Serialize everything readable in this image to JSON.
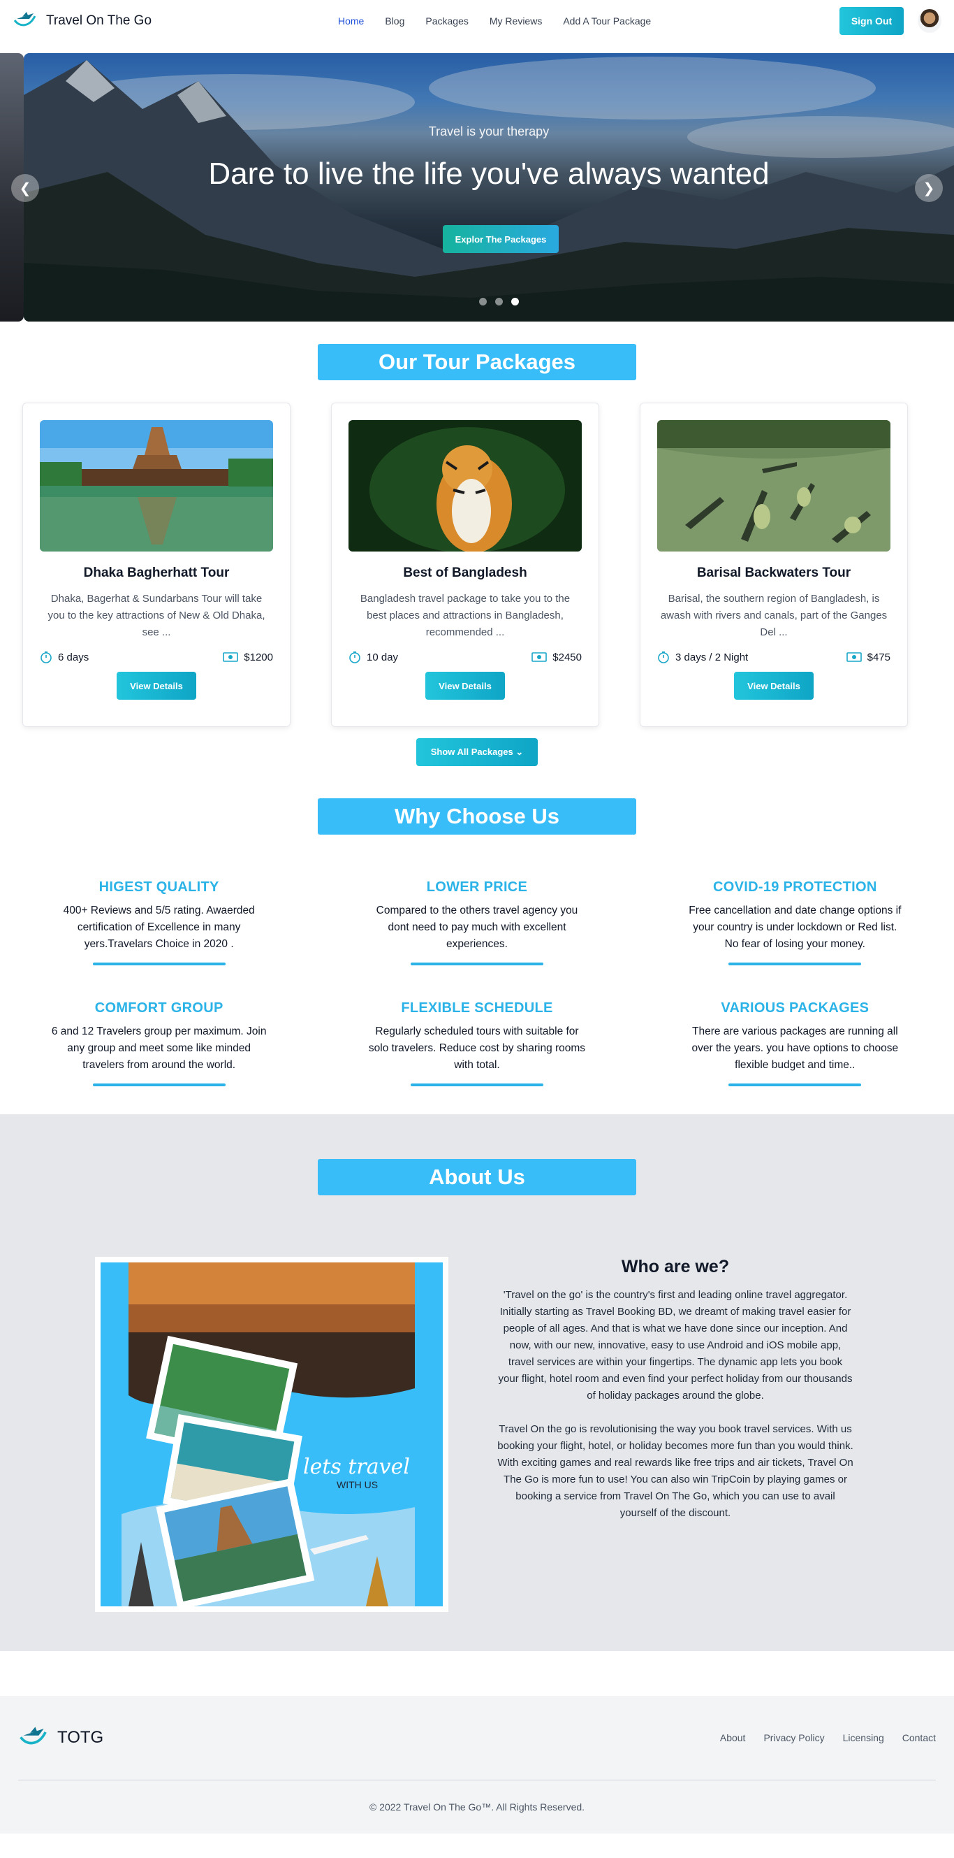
{
  "nav": {
    "brand": "Travel On The Go",
    "links": [
      "Home",
      "Blog",
      "Packages",
      "My Reviews",
      "Add A Tour Package"
    ],
    "active_link": "Home",
    "signout_label": "Sign Out"
  },
  "hero": {
    "subtitle": "Travel is your therapy",
    "title": "Dare to live the life you've always wanted",
    "cta_label": "Explor The Packages",
    "slides_total": 3,
    "active_slide": 3
  },
  "packages": {
    "heading": "Our Tour Packages",
    "items": [
      {
        "title": "Dhaka Bagherhatt Tour",
        "description": "Dhaka, Bagerhat & Sundarbans Tour will take you to the key attractions of New & Old Dhaka, see ...",
        "duration": "6 days",
        "price": "$1200",
        "button": "View Details"
      },
      {
        "title": "Best of Bangladesh",
        "description": "Bangladesh travel package to take you to the best places and attractions in Bangladesh, recommended ...",
        "duration": "10 day",
        "price": "$2450",
        "button": "View Details"
      },
      {
        "title": "Barisal Backwaters Tour",
        "description": "Barisal, the southern region of Bangladesh, is awash with rivers and canals, part of the Ganges Del ...",
        "duration": "3 days / 2 Night",
        "price": "$475",
        "button": "View Details"
      }
    ],
    "show_all_label": "Show All Packages"
  },
  "why": {
    "heading": "Why Choose Us",
    "features": [
      {
        "title": "HIGEST QUALITY",
        "desc": "400+ Reviews and 5/5 rating. Awaerded certification of Excellence in many yers.Travelars Choice in 2020 ."
      },
      {
        "title": "LOWER PRICE",
        "desc": "Compared to the others travel agency you dont need to pay much with excellent experiences."
      },
      {
        "title": "COVID-19 PROTECTION",
        "desc": "Free cancellation and date change options if your country is under lockdown or Red list. No fear of losing your money."
      },
      {
        "title": "COMFORT GROUP",
        "desc": "6 and 12 Travelers group per maximum. Join any group and meet some like minded travelers from around the world."
      },
      {
        "title": "FLEXIBLE SCHEDULE",
        "desc": "Regularly scheduled tours with suitable for solo travelers. Reduce cost by sharing rooms with total."
      },
      {
        "title": "VARIOUS PACKAGES",
        "desc": "There are various packages are running all over the years. you have options to choose flexible budget and time.."
      }
    ]
  },
  "about": {
    "heading": "About Us",
    "subheading": "Who are we?",
    "art_text_line1": "lets travel",
    "art_text_line2": "WITH US",
    "paragraphs": [
      "'Travel on the go' is the country's first and leading online travel aggregator. Initially starting as Travel Booking BD, we dreamt of making travel easier for people of all ages. And that is what we have done since our inception. And now, with our new, innovative, easy to use Android and iOS mobile app, travel services are within your fingertips. The dynamic app lets you book your flight, hotel room and even find your perfect holiday from our thousands of holiday packages around the globe.",
      "Travel On the go is revolutionising the way you book travel services. With us booking your flight, hotel, or holiday becomes more fun than you would think. With exciting games and real rewards like free trips and air tickets, Travel On The Go is more fun to use! You can also win TripCoin by playing games or booking a service from Travel On The Go, which you can use to avail yourself of the discount."
    ]
  },
  "footer": {
    "brand": "TOTG",
    "links": [
      "About",
      "Privacy Policy",
      "Licensing",
      "Contact"
    ],
    "copyright": "© 2022 Travel On The Go™. All Rights Reserved."
  },
  "colors": {
    "accent": "#38bdf8",
    "button": "#17b9d6",
    "feature_title": "#2bb3e8",
    "nav_active": "#1d4ed8"
  }
}
